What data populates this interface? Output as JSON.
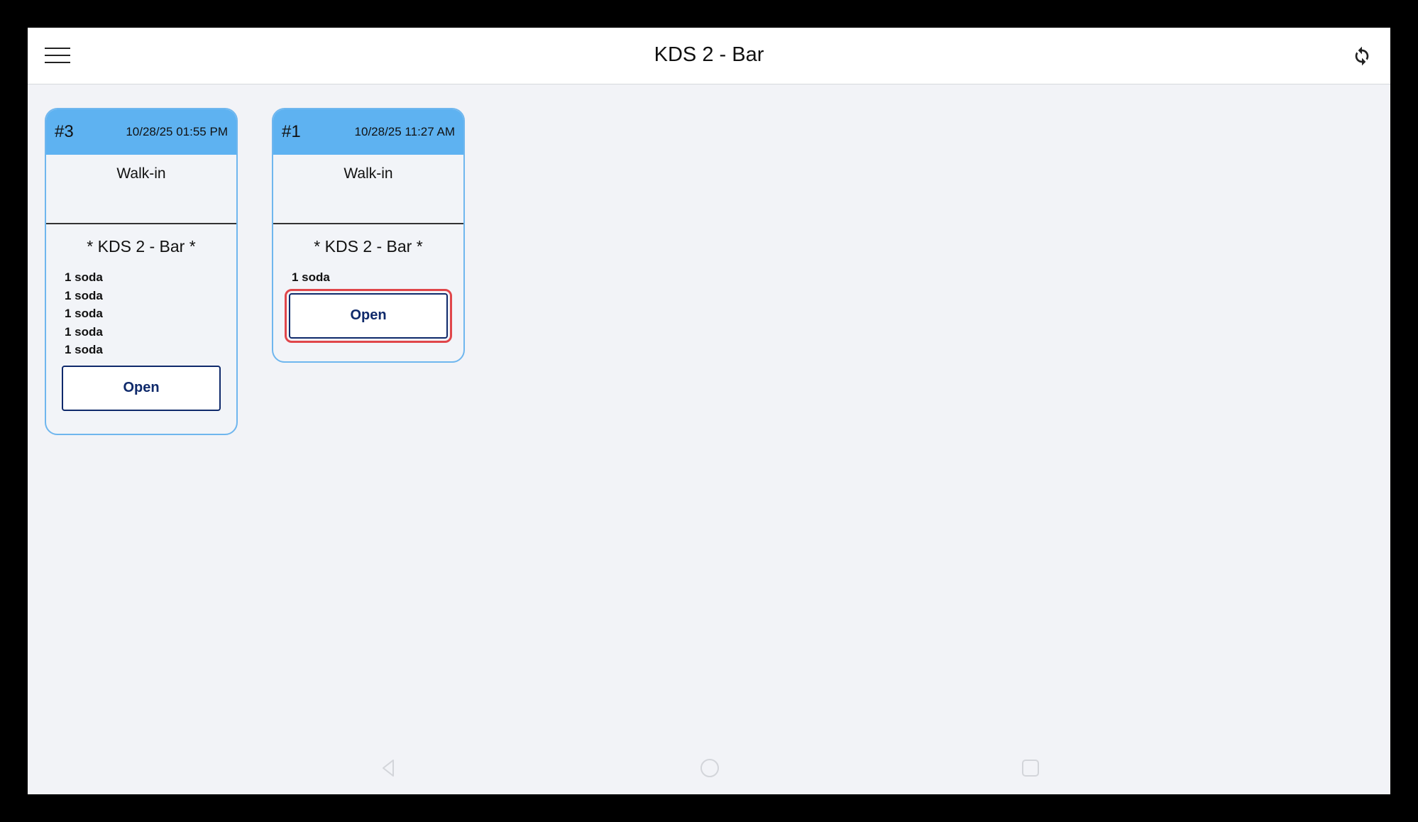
{
  "app_bar": {
    "title": "KDS 2 - Bar",
    "menu_icon": "hamburger-menu-icon",
    "refresh_icon": "refresh-icon"
  },
  "orders": [
    {
      "number": "#3",
      "time": "10/28/25 01:55 PM",
      "customer": "Walk-in",
      "station": "* KDS 2 - Bar *",
      "items": [
        "1 soda",
        "1 soda",
        "1 soda",
        "1 soda",
        "1 soda"
      ],
      "button_label": "Open"
    },
    {
      "number": "#1",
      "time": "10/28/25 11:27 AM",
      "customer": "Walk-in",
      "station": "* KDS 2 - Bar *",
      "items": [
        "1 soda"
      ],
      "button_label": "Open",
      "highlighted": true
    }
  ],
  "navigation_bar": {
    "back_icon": "back-triangle-icon",
    "home_icon": "home-circle-icon",
    "recents_icon": "recents-square-icon"
  },
  "colors": {
    "card_header": "#5eb2f1",
    "card_border": "#6fb6ee",
    "button_text": "#0f2a6b",
    "highlight": "#e0464a",
    "background": "#f2f3f7"
  }
}
